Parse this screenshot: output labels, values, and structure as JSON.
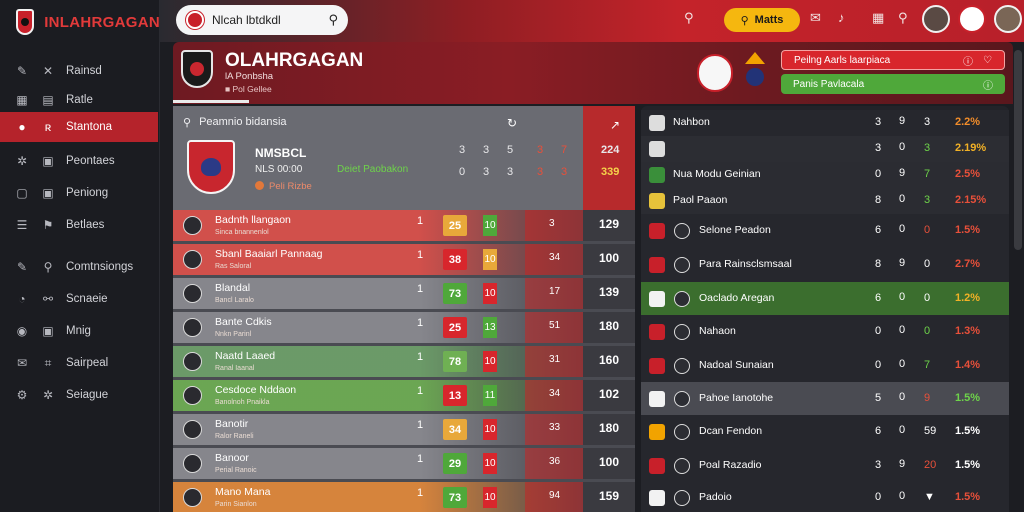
{
  "brand": {
    "name": "INLAHRGAGAN"
  },
  "sidebar": {
    "items": [
      {
        "label": "Rainsd",
        "icon1": "pencil-icon",
        "icon2": "chart-icon",
        "g1": "✎",
        "g2": "✕"
      },
      {
        "label": "Ratle",
        "icon1": "grid-icon",
        "icon2": "table-icon",
        "g1": "▦",
        "g2": "▤"
      },
      {
        "label": "Stantona",
        "icon1": "ball-icon",
        "icon2": "tag-icon",
        "g1": "●",
        "g2": "ʀ"
      },
      {
        "label": "Peontaes",
        "icon1": "group-icon",
        "icon2": "square-icon",
        "g1": "✲",
        "g2": "▣"
      },
      {
        "label": "Peniong",
        "icon1": "box-icon",
        "icon2": "square-icon",
        "g1": "▢",
        "g2": "▣"
      },
      {
        "label": "Betlaes",
        "icon1": "list-icon",
        "icon2": "flag-icon",
        "g1": "☰",
        "g2": "⚑"
      },
      {
        "label": "Comtnsiongs",
        "icon1": "edit-icon",
        "icon2": "link-icon",
        "g1": "✎",
        "g2": "⚲"
      },
      {
        "label": "Scnaeie",
        "icon1": "clock-icon",
        "icon2": "whistle-icon",
        "g1": "◔",
        "g2": "⚯"
      },
      {
        "label": "Mnig",
        "icon1": "circle-icon",
        "icon2": "square-icon",
        "g1": "◉",
        "g2": "▣"
      },
      {
        "label": "Sairpeal",
        "icon1": "message-icon",
        "icon2": "bookmark-icon",
        "g1": "✉",
        "g2": "⌗"
      },
      {
        "label": "Seiague",
        "icon1": "gear-icon",
        "icon2": "settings-icon",
        "g1": "⚙",
        "g2": "✲"
      }
    ]
  },
  "topbar": {
    "search_value": "Nlcah lbtdkdl",
    "button_label": "Matts",
    "icons": [
      "search-icon",
      "chat-icon",
      "bell-icon",
      "grid-icon",
      "search-icon"
    ]
  },
  "header": {
    "title": "OLAHRGAGAN",
    "sub": "lA Ponbsha",
    "sub2": "■ Pol Gellee",
    "alert1": "Peilng Aarls laarpiaca",
    "alert2": "Panis Pavlacala"
  },
  "table": {
    "title": "Peamnio bidansia",
    "club_code": "NMSBCL",
    "line2": "NLS 00:00",
    "line2_green": "Deiet Paobakon",
    "line3": "Peli Rizbe",
    "header_nums": [
      "3",
      "3",
      "5",
      "3",
      "7",
      "224"
    ],
    "header_nums2": [
      "0",
      "3",
      "3",
      "3",
      "3",
      "339"
    ],
    "rows": [
      {
        "name": "Badnth llangaon",
        "sub": "Sinca bnannenlol",
        "m1": "1",
        "box": "25",
        "chip": "10",
        "m3": "3",
        "total": "129",
        "color": "#e0504a"
      },
      {
        "name": "Sbanl Baaiarl Pannaag",
        "sub": "Ras Saloral",
        "m1": "1",
        "box": "38",
        "chip": "10",
        "m3": "34",
        "total": "100",
        "color": "#e0504a"
      },
      {
        "name": "Blandal",
        "sub": "Bancl Laralo",
        "m1": "1",
        "box": "73",
        "chip": "10",
        "m3": "17",
        "total": "139",
        "color": "#8d8d93"
      },
      {
        "name": "Bante Cdkis",
        "sub": "Nnkn Parinl",
        "m1": "1",
        "box": "25",
        "chip": "13",
        "m3": "51",
        "total": "180",
        "color": "#8d8d93"
      },
      {
        "name": "Naatd Laaed",
        "sub": "Ranal Iaanal",
        "m1": "1",
        "box": "78",
        "chip": "10",
        "m3": "31",
        "total": "160",
        "color": "#6fa36a"
      },
      {
        "name": "Cesdoce Nddaon",
        "sub": "Banolnoh Pnaikla",
        "m1": "1",
        "box": "13",
        "chip": "11",
        "m3": "34",
        "total": "102",
        "color": "#6fb053"
      },
      {
        "name": "Banotir",
        "sub": "Ralor Raneli",
        "m1": "1",
        "box": "34",
        "chip": "10",
        "m3": "33",
        "total": "180",
        "color": "#8d8d93"
      },
      {
        "name": "Banoor",
        "sub": "Perial Ranoic",
        "m1": "1",
        "box": "29",
        "chip": "10",
        "m3": "36",
        "total": "100",
        "color": "#8d8d93"
      },
      {
        "name": "Mano Mana",
        "sub": "Parin Sianlon",
        "m1": "1",
        "box": "73",
        "chip": "10",
        "m3": "94",
        "total": "159",
        "color": "#e68a3a"
      }
    ]
  },
  "standings": [
    {
      "name": "Nahbon",
      "c1": "3",
      "c2": "9",
      "c3": "3",
      "pct": "2.2%",
      "pct_color": "#f28d2a",
      "c3_color": "#fff",
      "rowbg": "#26272d",
      "icon": "ball-icon"
    },
    {
      "name": "",
      "c1": "3",
      "c2": "0",
      "c3": "3",
      "pct": "2.19%",
      "pct_color": "#f2b126",
      "c3_color": "#6ed44a",
      "rowbg": "#2c2d33",
      "icon": "shield-icon"
    },
    {
      "name": "Nua Modu Geinian",
      "c1": "0",
      "c2": "9",
      "c3": "7",
      "pct": "2.5%",
      "pct_color": "#e8503a",
      "c3_color": "#6ed44a",
      "rowbg": "#2b2c32",
      "icon": "tile-icon"
    },
    {
      "name": "Paol Paaon",
      "c1": "8",
      "c2": "0",
      "c3": "3",
      "pct": "2.15%",
      "pct_color": "#e8503a",
      "c3_color": "#6ed44a",
      "rowbg": "#2b2c32",
      "icon": "crest-icon"
    },
    {
      "name": "Selone Peadon",
      "c1": "6",
      "c2": "0",
      "c3": "0",
      "pct": "1.5%",
      "pct_color": "#e8503a",
      "c3_color": "#e8503a",
      "rowbg": "#26272d",
      "icon": "crest-icon"
    },
    {
      "name": "Para Rainsclsmsaal",
      "c1": "8",
      "c2": "9",
      "c3": "0",
      "pct": "2.7%",
      "pct_color": "#e8503a",
      "c3_color": "#fff",
      "rowbg": "#26272d",
      "icon": "crest-icon"
    },
    {
      "name": "Oaclado Aregan",
      "c1": "6",
      "c2": "0",
      "c3": "0",
      "pct": "1.2%",
      "pct_color": "#f2b126",
      "c3_color": "#fff",
      "rowbg": "#3b6e2e",
      "icon": "crest-icon"
    },
    {
      "name": "Nahaon",
      "c1": "0",
      "c2": "0",
      "c3": "0",
      "pct": "1.3%",
      "pct_color": "#e8503a",
      "c3_color": "#6ed44a",
      "rowbg": "#26272d",
      "icon": "crest-icon"
    },
    {
      "name": "Nadoal Sunaian",
      "c1": "0",
      "c2": "0",
      "c3": "7",
      "pct": "1.4%",
      "pct_color": "#e8503a",
      "c3_color": "#6ed44a",
      "rowbg": "#26272d",
      "icon": "crest-icon"
    },
    {
      "name": "Pahoe Ianotohe",
      "c1": "5",
      "c2": "0",
      "c3": "9",
      "pct": "1.5%",
      "pct_color": "#6ed44a",
      "c3_color": "#e8503a",
      "rowbg": "#4a4b52",
      "icon": "crest-icon"
    },
    {
      "name": "Dcan Fendon",
      "c1": "6",
      "c2": "0",
      "c3": "59",
      "pct": "1.5%",
      "pct_color": "#fff",
      "c3_color": "#fff",
      "rowbg": "#26272d",
      "icon": "crest-icon"
    },
    {
      "name": "Poal Razadio",
      "c1": "3",
      "c2": "9",
      "c3": "20",
      "pct": "1.5%",
      "pct_color": "#fff",
      "c3_color": "#e8503a",
      "rowbg": "#26272d",
      "icon": "crest-icon"
    },
    {
      "name": "Padoio",
      "c1": "0",
      "c2": "0",
      "c3": "▼",
      "pct": "1.5%",
      "pct_color": "#e8503a",
      "c3_color": "#fff",
      "rowbg": "#26272d",
      "icon": "crest-icon"
    }
  ],
  "colors": {
    "accent": "#c8202a",
    "green": "#6ed44a",
    "orange": "#f2b126"
  }
}
